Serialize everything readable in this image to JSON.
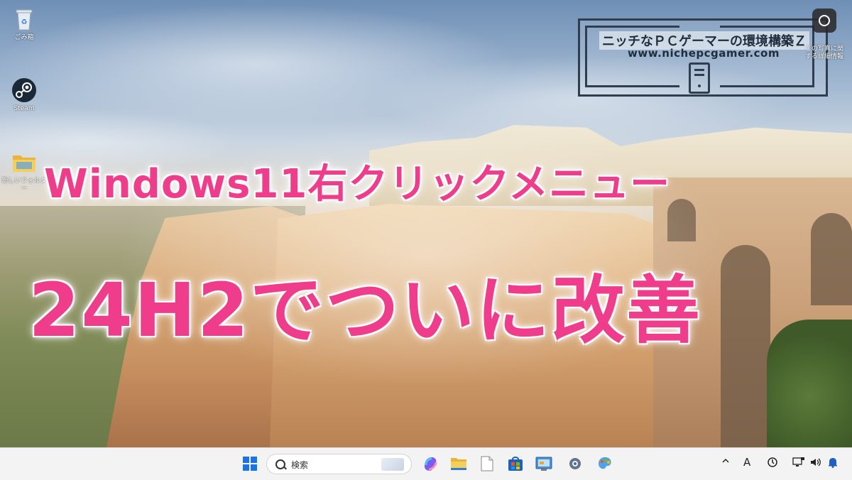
{
  "desktop": {
    "icons": [
      {
        "label": "ごみ箱",
        "icon": "recycle-bin-icon"
      },
      {
        "label": "Steam",
        "icon": "steam-icon"
      },
      {
        "label": "新しいフォルダー",
        "icon": "folder-icon"
      }
    ],
    "learn_more": {
      "label_line1": "この写真に関",
      "label_line2": "する詳細情報",
      "icon": "learn-about-picture-icon"
    }
  },
  "headline": {
    "line1": "Windows11右クリックメニュー",
    "line2": "24H2でついに改善",
    "color": "#ef3d8c"
  },
  "brand": {
    "title": "ニッチなＰＣゲーマーの環境構築Ｚ",
    "url": "www.nichepcgamer.com"
  },
  "taskbar": {
    "search_placeholder": "検索",
    "pinned_icons": [
      "windows-start-icon",
      "search-icon",
      "copilot-icon",
      "file-explorer-icon",
      "notepad-icon",
      "microsoft-store-icon",
      "control-panel-icon",
      "settings-icon",
      "paint-icon"
    ],
    "tray": {
      "ime_label": "A",
      "icons": [
        "chevron-up-icon",
        "ime-icon",
        "clock-icon",
        "network-icon",
        "volume-icon",
        "notification-bell-icon"
      ]
    }
  }
}
